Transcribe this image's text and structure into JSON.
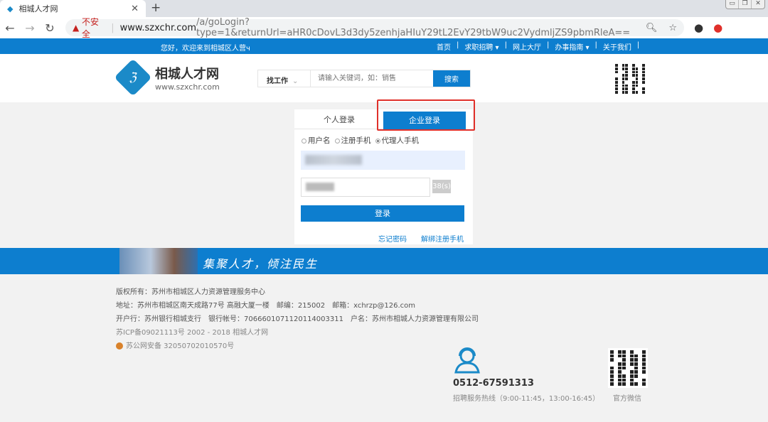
{
  "browser": {
    "tab_title": "相城人才网",
    "url_warning": "不安全",
    "url_host": "www.szxchr.com",
    "url_path": "/a/goLogin?type=1&returnUrl=aHR0cDovL3d3dy5zenhjaHIuY29tL2EvY29tbW9uc2VydmljZS9pbmRleA=="
  },
  "topbar": {
    "welcome": "您好，欢迎来到相城区人营ч",
    "nav": [
      "首页",
      "求职招聘 ▾",
      "网上大厅",
      "办事指南 ▾",
      "关于我们"
    ]
  },
  "header": {
    "logo_name": "相城人才网",
    "logo_url": "www.szxchr.com",
    "search_category": "找工作",
    "search_placeholder": "请输入关键词，如：销售",
    "search_button": "搜索"
  },
  "login": {
    "tabs": [
      "个人登录",
      "企业登录"
    ],
    "active_tab": "企业登录",
    "radio_options": [
      "用户名",
      "注册手机",
      "代理人手机"
    ],
    "selected_radio": "代理人手机",
    "countdown": "38(s)",
    "submit": "登录",
    "forgot": "忘记密码",
    "unbind": "解绑注册手机"
  },
  "banner": {
    "slogan": "集聚人才，倾注民生"
  },
  "footer": {
    "copyright": "版权所有：苏州市相城区人力资源管理服务中心",
    "address": "地址：苏州市相城区南天成路77号 高融大厦一楼　邮编：215002　邮箱：xchrzp@126.com",
    "bank": "开户行：苏州银行相城支行　银行帐号：7066601071120114003311　户名：苏州市相城人力资源管理有限公司",
    "icp": "苏ICP备09021113号 2002 - 2018 相城人才网",
    "police": "苏公网安备 32050702010570号"
  },
  "hotline": {
    "number": "0512-67591313",
    "desc": "招聘服务热线（9:00-11:45，13:00-16:45）"
  },
  "wechat": {
    "label": "官方微信"
  },
  "colors": {
    "brand": "#0d7ecf",
    "highlight": "#e0302a"
  }
}
